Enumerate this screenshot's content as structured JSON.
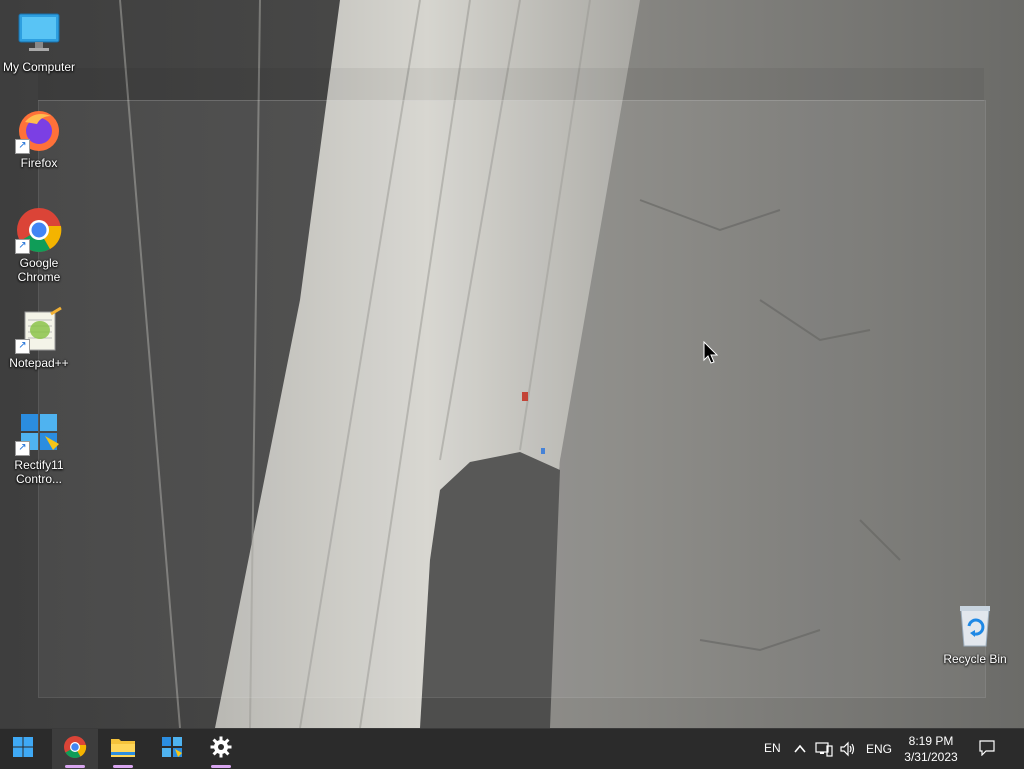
{
  "desktop": {
    "icons": [
      {
        "label": "My Computer",
        "icon": "computer-icon"
      },
      {
        "label": "Firefox",
        "icon": "firefox-icon"
      },
      {
        "label": "Google Chrome",
        "icon": "chrome-icon"
      },
      {
        "label": "Notepad++",
        "icon": "notepad-plus-plus-icon"
      },
      {
        "label": "Rectify11 Contro...",
        "icon": "rectify11-control-panel-icon"
      },
      {
        "label": "Recycle Bin",
        "icon": "recycle-bin-icon"
      }
    ]
  },
  "taskbar": {
    "apps": [
      {
        "name": "Start",
        "icon": "windows-start-icon"
      },
      {
        "name": "Google Chrome",
        "icon": "chrome-icon",
        "active": true
      },
      {
        "name": "File Explorer",
        "icon": "folder-icon"
      },
      {
        "name": "Rectify11 Control Panel",
        "icon": "control-panel-icon"
      },
      {
        "name": "Settings",
        "icon": "gear-icon"
      }
    ],
    "tray": {
      "input_lang_short": "EN",
      "keyboard_lang": "ENG",
      "time": "8:19 PM",
      "date": "3/31/2023"
    }
  },
  "colors": {
    "taskbar_bg": "#2b2b2b",
    "active_indicator": "#d9a6f0",
    "wallpaper_rock": "#8a8a86"
  }
}
